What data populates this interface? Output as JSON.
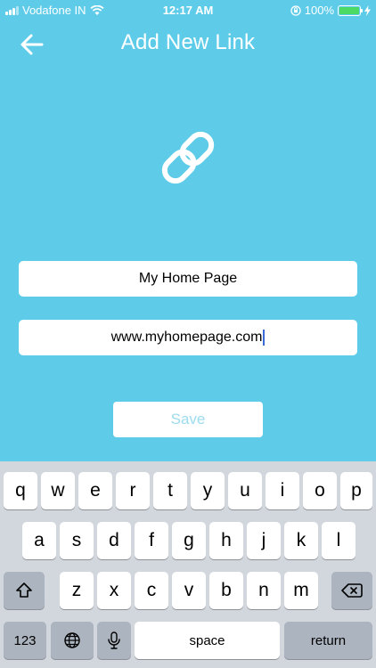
{
  "status_bar": {
    "carrier": "Vodafone IN",
    "time": "12:17 AM",
    "battery": "100%"
  },
  "header": {
    "title": "Add New Link"
  },
  "form": {
    "name_value": "My Home Page",
    "url_value": "www.myhomepage.com",
    "save_label": "Save"
  },
  "keyboard": {
    "row1": [
      "q",
      "w",
      "e",
      "r",
      "t",
      "y",
      "u",
      "i",
      "o",
      "p"
    ],
    "row2": [
      "a",
      "s",
      "d",
      "f",
      "g",
      "h",
      "j",
      "k",
      "l"
    ],
    "row3": [
      "z",
      "x",
      "c",
      "v",
      "b",
      "n",
      "m"
    ],
    "numbers_label": "123",
    "space_label": "space",
    "return_label": "return"
  },
  "colors": {
    "background": "#5ecce9",
    "save_text": "#9ddcee",
    "keyboard_bg": "#d2d6dd"
  }
}
